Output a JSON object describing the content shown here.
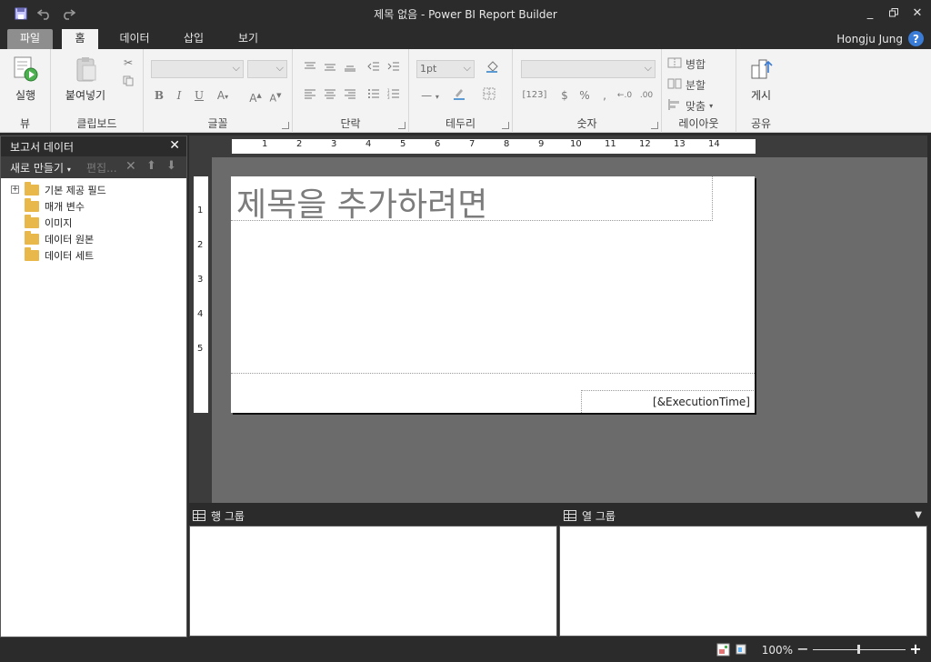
{
  "window": {
    "title": "제목 없음 - Power BI Report Builder"
  },
  "tabs": {
    "file": "파일",
    "home": "홈",
    "data": "데이터",
    "insert": "삽입",
    "view": "보기"
  },
  "user": {
    "name": "Hongju Jung",
    "help": "?"
  },
  "ribbon": {
    "view": {
      "run": "실행",
      "label": "뷰"
    },
    "clipboard": {
      "paste": "붙여넣기",
      "label": "클립보드"
    },
    "font": {
      "label": "글꼴"
    },
    "paragraph": {
      "label": "단락"
    },
    "border": {
      "size": "1pt",
      "label": "테두리"
    },
    "number": {
      "label": "숫자"
    },
    "layout": {
      "merge": "병합",
      "split": "분할",
      "align": "맞춤",
      "label": "레이아웃"
    },
    "share": {
      "publish": "게시",
      "label": "공유"
    }
  },
  "report_data": {
    "title": "보고서 데이터",
    "new": "새로 만들기",
    "edit": "편집...",
    "items": [
      "기본 제공 필드",
      "매개 변수",
      "이미지",
      "데이터 원본",
      "데이터 세트"
    ]
  },
  "design": {
    "title_placeholder": "제목을 추가하려면",
    "execution_time": "[&ExecutionTime]",
    "hruler": [
      "1",
      "2",
      "3",
      "4",
      "5",
      "6",
      "7",
      "8",
      "9",
      "10",
      "11",
      "12",
      "13",
      "14"
    ],
    "vruler": [
      "1",
      "2",
      "3",
      "4",
      "5"
    ]
  },
  "groups": {
    "row": "행 그룹",
    "column": "열 그룹"
  },
  "status": {
    "zoom": "100%"
  }
}
